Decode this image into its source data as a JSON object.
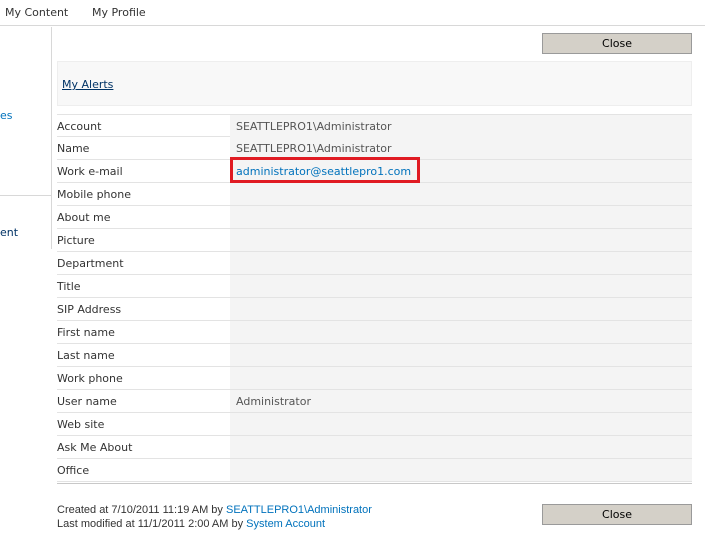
{
  "top_nav": {
    "tabs": [
      {
        "label": "My Content"
      },
      {
        "label": "My Profile"
      }
    ]
  },
  "left_nav": {
    "fragment_1": "es",
    "fragment_2": "ent"
  },
  "buttons": {
    "close_top": "Close",
    "close_bottom": "Close"
  },
  "alerts": {
    "link_label": "My Alerts"
  },
  "properties": [
    {
      "label": "Account",
      "value": "SEATTLEPRO1\\Administrator"
    },
    {
      "label": "Name",
      "value": "SEATTLEPRO1\\Administrator"
    },
    {
      "label": "Work e-mail",
      "value": "administrator@seattlepro1.com",
      "is_link": true
    },
    {
      "label": "Mobile phone",
      "value": ""
    },
    {
      "label": "About me",
      "value": ""
    },
    {
      "label": "Picture",
      "value": ""
    },
    {
      "label": "Department",
      "value": ""
    },
    {
      "label": "Title",
      "value": ""
    },
    {
      "label": "SIP Address",
      "value": ""
    },
    {
      "label": "First name",
      "value": ""
    },
    {
      "label": "Last name",
      "value": ""
    },
    {
      "label": "Work phone",
      "value": ""
    },
    {
      "label": "User name",
      "value": "Administrator"
    },
    {
      "label": "Web site",
      "value": ""
    },
    {
      "label": "Ask Me About",
      "value": ""
    },
    {
      "label": "Office",
      "value": ""
    }
  ],
  "footer": {
    "created_prefix": "Created at 7/10/2011 11:19 AM by ",
    "created_by": "SEATTLEPRO1\\Administrator",
    "modified_prefix": "Last modified at 11/1/2011 2:00 AM by ",
    "modified_by": "System Account"
  },
  "colors": {
    "link": "#0072bc",
    "highlight_border": "#e01b23",
    "value_background": "#f4f4f4",
    "button_face": "#d4d0c8"
  }
}
